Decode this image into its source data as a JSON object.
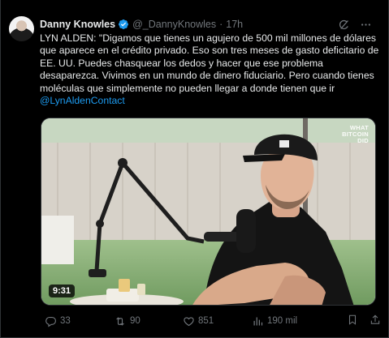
{
  "author": {
    "name": "Danny Knowles",
    "handle": "@_DannyKnowles",
    "separator": "·",
    "time": "17h"
  },
  "post": {
    "text": "LYN ALDEN: \"Digamos que tienes un agujero de 500 mil millones de dólares que aparece en el crédito privado. Eso son tres meses de gasto deficitario de EE. UU. Puedes chasquear los dedos y hacer que ese problema desaparezca. Vivimos en un mundo de dinero fiduciario. Pero cuando tienes moléculas que simplemente no pueden llegar a donde tienen que ir",
    "mention": "@LynAldenContact"
  },
  "media": {
    "duration": "9:31",
    "watermark_line1": "WHAT",
    "watermark_line2": "BITCOIN",
    "watermark_line3": "DID"
  },
  "actions": {
    "replies": "33",
    "reposts": "90",
    "likes": "851",
    "views": "190 mil"
  },
  "colors": {
    "background": "#000000",
    "text": "#e7e9ea",
    "muted": "#71767b",
    "accent": "#1d9bf0",
    "border": "#2f3336"
  },
  "icons": [
    "verified-badge-icon",
    "grok-icon",
    "more-icon",
    "reply-icon",
    "repost-icon",
    "like-icon",
    "views-icon",
    "bookmark-icon",
    "share-icon"
  ]
}
